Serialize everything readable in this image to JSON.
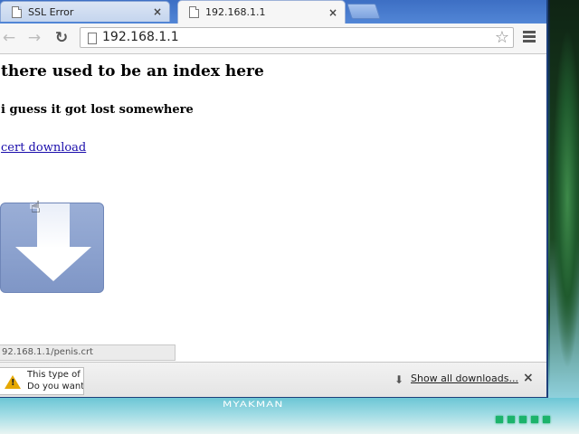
{
  "tabs": [
    {
      "title": "SSL Error",
      "close": "×"
    },
    {
      "title": "192.168.1.1",
      "close": "×"
    }
  ],
  "toolbar": {
    "back": "←",
    "forward": "→",
    "reload": "↻",
    "url": "192.168.1.1",
    "star": "☆"
  },
  "content": {
    "heading1": "there used to be an index here",
    "heading2": "i guess it got lost somewhere",
    "link": "cert download"
  },
  "status_bubble": "92.168.1.1/penis.crt",
  "download_bar": {
    "warning_mark": "!",
    "line1": "This type of f",
    "line2": "Do you want",
    "arrow": "⬇",
    "show_all": "Show all downloads...",
    "close": "×"
  },
  "desktop": {
    "tray_text": "MYAKMAN"
  },
  "icons": [
    "page-icon",
    "star-icon",
    "menu-icon",
    "warning-icon",
    "download-arrow-icon",
    "hand-cursor-icon"
  ]
}
